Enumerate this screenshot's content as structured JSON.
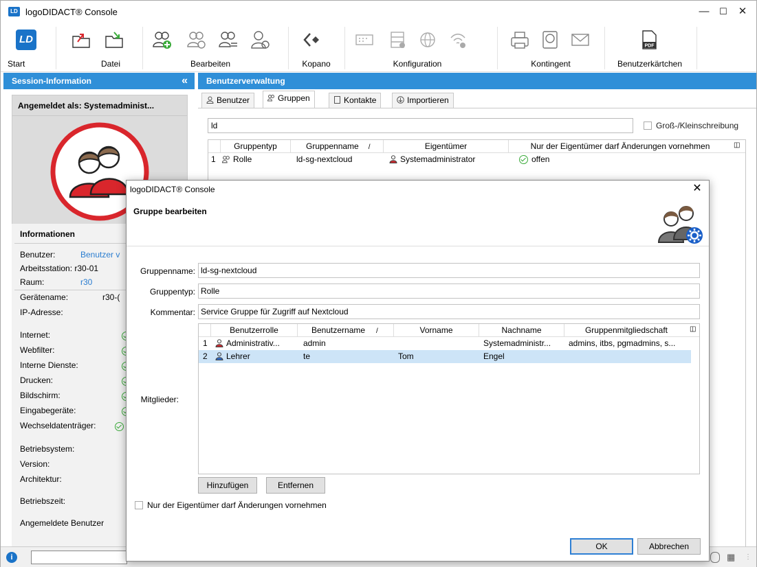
{
  "window": {
    "title": "logoDIDACT® Console",
    "icon_text": "LD"
  },
  "ribbon": {
    "groups": [
      {
        "label": "Start"
      },
      {
        "label": "Datei"
      },
      {
        "label": "Bearbeiten"
      },
      {
        "label": "Kopano"
      },
      {
        "label": "Konfiguration"
      },
      {
        "label": "Kontingent"
      },
      {
        "label": "Benutzerkärtchen"
      }
    ],
    "pdf_text": "PDF",
    "start_icon_text": "LD"
  },
  "left": {
    "header": "Session-Information",
    "logged_in_as": "Angemeldet als: Systemadminist...",
    "info_header": "Informationen",
    "rows": [
      {
        "label": "Benutzer:",
        "value": "Benutzer v"
      },
      {
        "label": "Arbeitsstation: r30-01",
        "value": ""
      },
      {
        "label": "Raum:",
        "value": "r30"
      },
      {
        "label": "Gerätename:",
        "value": "r30-("
      },
      {
        "label": "IP-Adresse:",
        "value": ""
      }
    ],
    "checks": [
      "Internet:",
      "Webfilter:",
      "Interne Dienste:",
      "Drucken:",
      "Bildschirm:",
      "Eingabegeräte:",
      "Wechseldatenträger:"
    ],
    "sys": [
      "Betriebsystem:",
      "Version:",
      "Architektur:",
      "Betriebszeit:",
      "Angemeldete Benutzer"
    ]
  },
  "main": {
    "header": "Benutzerverwaltung",
    "tabs": [
      "Benutzer",
      "Gruppen",
      "Kontakte",
      "Importieren"
    ],
    "filter_value": "ld",
    "case_label": "Groß-/Kleinschreibung",
    "columns": [
      "Gruppentyp",
      "Gruppenname",
      "/",
      "Eigentümer",
      "Nur der Eigentümer darf Änderungen vornehmen"
    ],
    "rows": [
      {
        "num": "1",
        "type": "Rolle",
        "name": "ld-sg-nextcloud",
        "owner": "Systemadministrator",
        "restricted": "offen"
      }
    ]
  },
  "dialog": {
    "title": "logoDIDACT® Console",
    "heading": "Gruppe bearbeiten",
    "name_label": "Gruppenname:",
    "name_value": "ld-sg-nextcloud",
    "type_label": "Gruppentyp:",
    "type_value": "Rolle",
    "comment_label": "Kommentar:",
    "comment_value": "Service Gruppe für Zugriff auf Nextcloud",
    "members_label": "Mitglieder:",
    "columns": [
      "Benutzerrolle",
      "Benutzername",
      "/",
      "Vorname",
      "Nachname",
      "Gruppenmitgliedschaft"
    ],
    "members": [
      {
        "num": "1",
        "role": "Administrativ...",
        "user": "admin",
        "first": "",
        "last": "Systemadministr...",
        "groups": "admins, itbs, pgmadmins, s..."
      },
      {
        "num": "2",
        "role": "Lehrer",
        "user": "te",
        "first": "Tom",
        "last": "Engel",
        "groups": ""
      }
    ],
    "add_label": "Hinzufügen",
    "remove_label": "Entfernen",
    "owner_only_label": "Nur der Eigentümer darf Änderungen vornehmen",
    "ok_label": "OK",
    "cancel_label": "Abbrechen"
  },
  "colors": {
    "accent": "#2f8fd8",
    "selection": "#cde4f7",
    "check_green": "#3aaa3a",
    "avatar_red": "#d9262c"
  }
}
